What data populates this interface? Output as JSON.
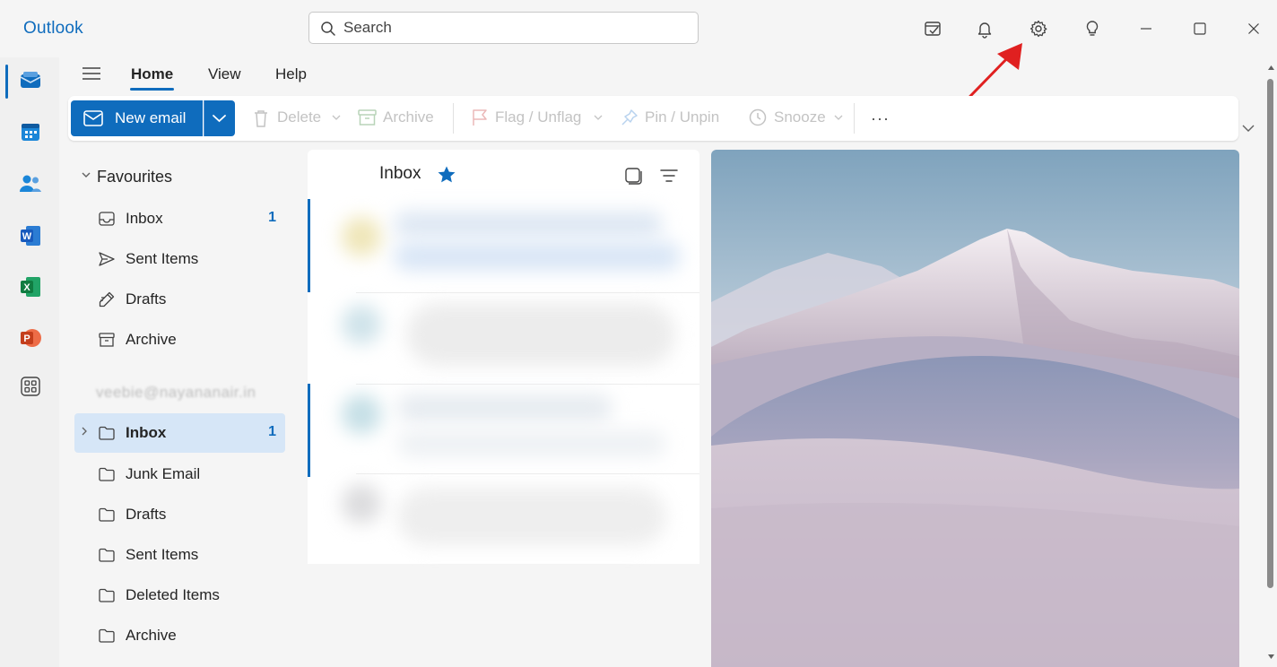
{
  "app": {
    "title": "Outlook"
  },
  "search": {
    "placeholder": "Search"
  },
  "titlebar_icons": [
    "my-day-icon",
    "bell-icon",
    "gear-icon",
    "lightbulb-icon",
    "minimize-icon",
    "maximize-icon",
    "close-icon"
  ],
  "rail": [
    "mail-icon",
    "calendar-icon",
    "people-icon",
    "word-icon",
    "excel-icon",
    "powerpoint-icon",
    "apps-icon"
  ],
  "rail_badges": {
    "word": "W",
    "excel": "X",
    "powerpoint": "P"
  },
  "tabs": {
    "home": "Home",
    "view": "View",
    "help": "Help"
  },
  "ribbon": {
    "new_email": "New email",
    "delete": "Delete",
    "archive": "Archive",
    "flag": "Flag / Unflag",
    "pin": "Pin / Unpin",
    "snooze": "Snooze",
    "more": "···"
  },
  "favourites": {
    "header": "Favourites",
    "items": [
      {
        "label": "Inbox",
        "count": "1"
      },
      {
        "label": "Sent Items",
        "count": ""
      },
      {
        "label": "Drafts",
        "count": ""
      },
      {
        "label": "Archive",
        "count": ""
      }
    ]
  },
  "account": {
    "label": "veebie@nayananair.in",
    "folders": [
      {
        "label": "Inbox",
        "count": "1"
      },
      {
        "label": "Junk Email",
        "count": ""
      },
      {
        "label": "Drafts",
        "count": ""
      },
      {
        "label": "Sent Items",
        "count": ""
      },
      {
        "label": "Deleted Items",
        "count": ""
      },
      {
        "label": "Archive",
        "count": ""
      }
    ]
  },
  "message_list": {
    "title": "Inbox"
  },
  "colors": {
    "accent": "#0f6cbd",
    "annotation": "#e02020"
  }
}
